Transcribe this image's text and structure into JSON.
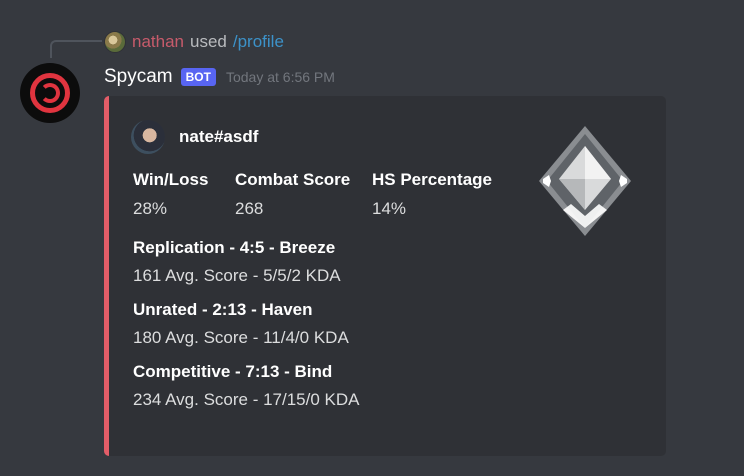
{
  "reply": {
    "user": "nathan",
    "used": "used",
    "command": "/profile"
  },
  "message": {
    "author": "Spycam",
    "bot_tag": "BOT",
    "timestamp": "Today at 6:56 PM"
  },
  "embed": {
    "accent_color": "#e35d68",
    "author_name": "nate#asdf",
    "fields": [
      {
        "name": "Win/Loss",
        "value": "28%"
      },
      {
        "name": "Combat Score",
        "value": "268"
      },
      {
        "name": "HS Percentage",
        "value": "14%"
      }
    ],
    "matches": [
      {
        "title": "Replication - 4:5 - Breeze",
        "desc": "161 Avg. Score - 5/5/2 KDA"
      },
      {
        "title": "Unrated - 2:13 - Haven",
        "desc": "180 Avg. Score - 11/4/0 KDA"
      },
      {
        "title": "Competitive - 7:13 - Bind",
        "desc": "234 Avg. Score - 17/15/0 KDA"
      }
    ],
    "thumbnail_icon": "rank-diamond-icon"
  }
}
